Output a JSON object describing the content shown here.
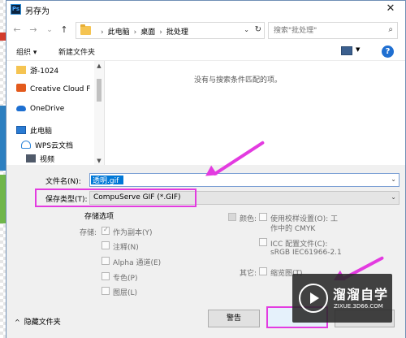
{
  "window": {
    "app_icon": "Ps",
    "title": "另存为",
    "close": "✕"
  },
  "address": {
    "back": "←",
    "forward": "→",
    "recent": "⌄",
    "up": "↑",
    "crumbs": [
      "此电脑",
      "桌面",
      "批处理"
    ],
    "separator": "›",
    "dropdown": "⌄",
    "refresh": "↻"
  },
  "search": {
    "placeholder": "搜索\"批处理\""
  },
  "toolbar": {
    "organize": "组织 ▾",
    "new_folder": "新建文件夹",
    "help": "?"
  },
  "nav": {
    "items": [
      {
        "label": "游-1024",
        "icon": "folder-icon"
      },
      {
        "label": "Creative Cloud F",
        "icon": "creative-cloud-icon"
      },
      {
        "label": "OneDrive",
        "icon": "onedrive-icon"
      },
      {
        "label": "此电脑",
        "icon": "this-pc-icon"
      },
      {
        "label": "WPS云文档",
        "icon": "wps-cloud-icon"
      },
      {
        "label": "视频",
        "icon": "video-icon"
      }
    ]
  },
  "files": {
    "empty_message": "没有与搜索条件匹配的项。"
  },
  "form": {
    "filename_label": "文件名(N):",
    "filename_value": "透明.gif",
    "filetype_label": "保存类型(T):",
    "filetype_value": "CompuServe GIF (*.GIF)"
  },
  "options": {
    "section_title": "存储选项",
    "save_label": "存储:",
    "as_copy": "作为副本(Y)",
    "annotations": "注释(N)",
    "alpha": "Alpha 通道(E)",
    "spot": "专色(P)",
    "layers": "图层(L)",
    "color_label": "颜色:",
    "proof_setup": "使用校样设置(O): 工",
    "proof_setup_2": "作中的 CMYK",
    "icc_profile": "ICC 配置文件(C):",
    "icc_profile_2": "sRGB IEC61966-2.1",
    "other_label": "其它:",
    "thumbnail": "缩览图(T)"
  },
  "footer": {
    "hide_folders": "隐藏文件夹",
    "warning_button": "警告",
    "save_button": "",
    "cancel_button": ""
  },
  "watermark": {
    "name": "溜溜自学",
    "url": "ZIXUE.3D66.COM"
  },
  "colors": {
    "annotation": "#e33be0",
    "accent": "#0078d7"
  }
}
